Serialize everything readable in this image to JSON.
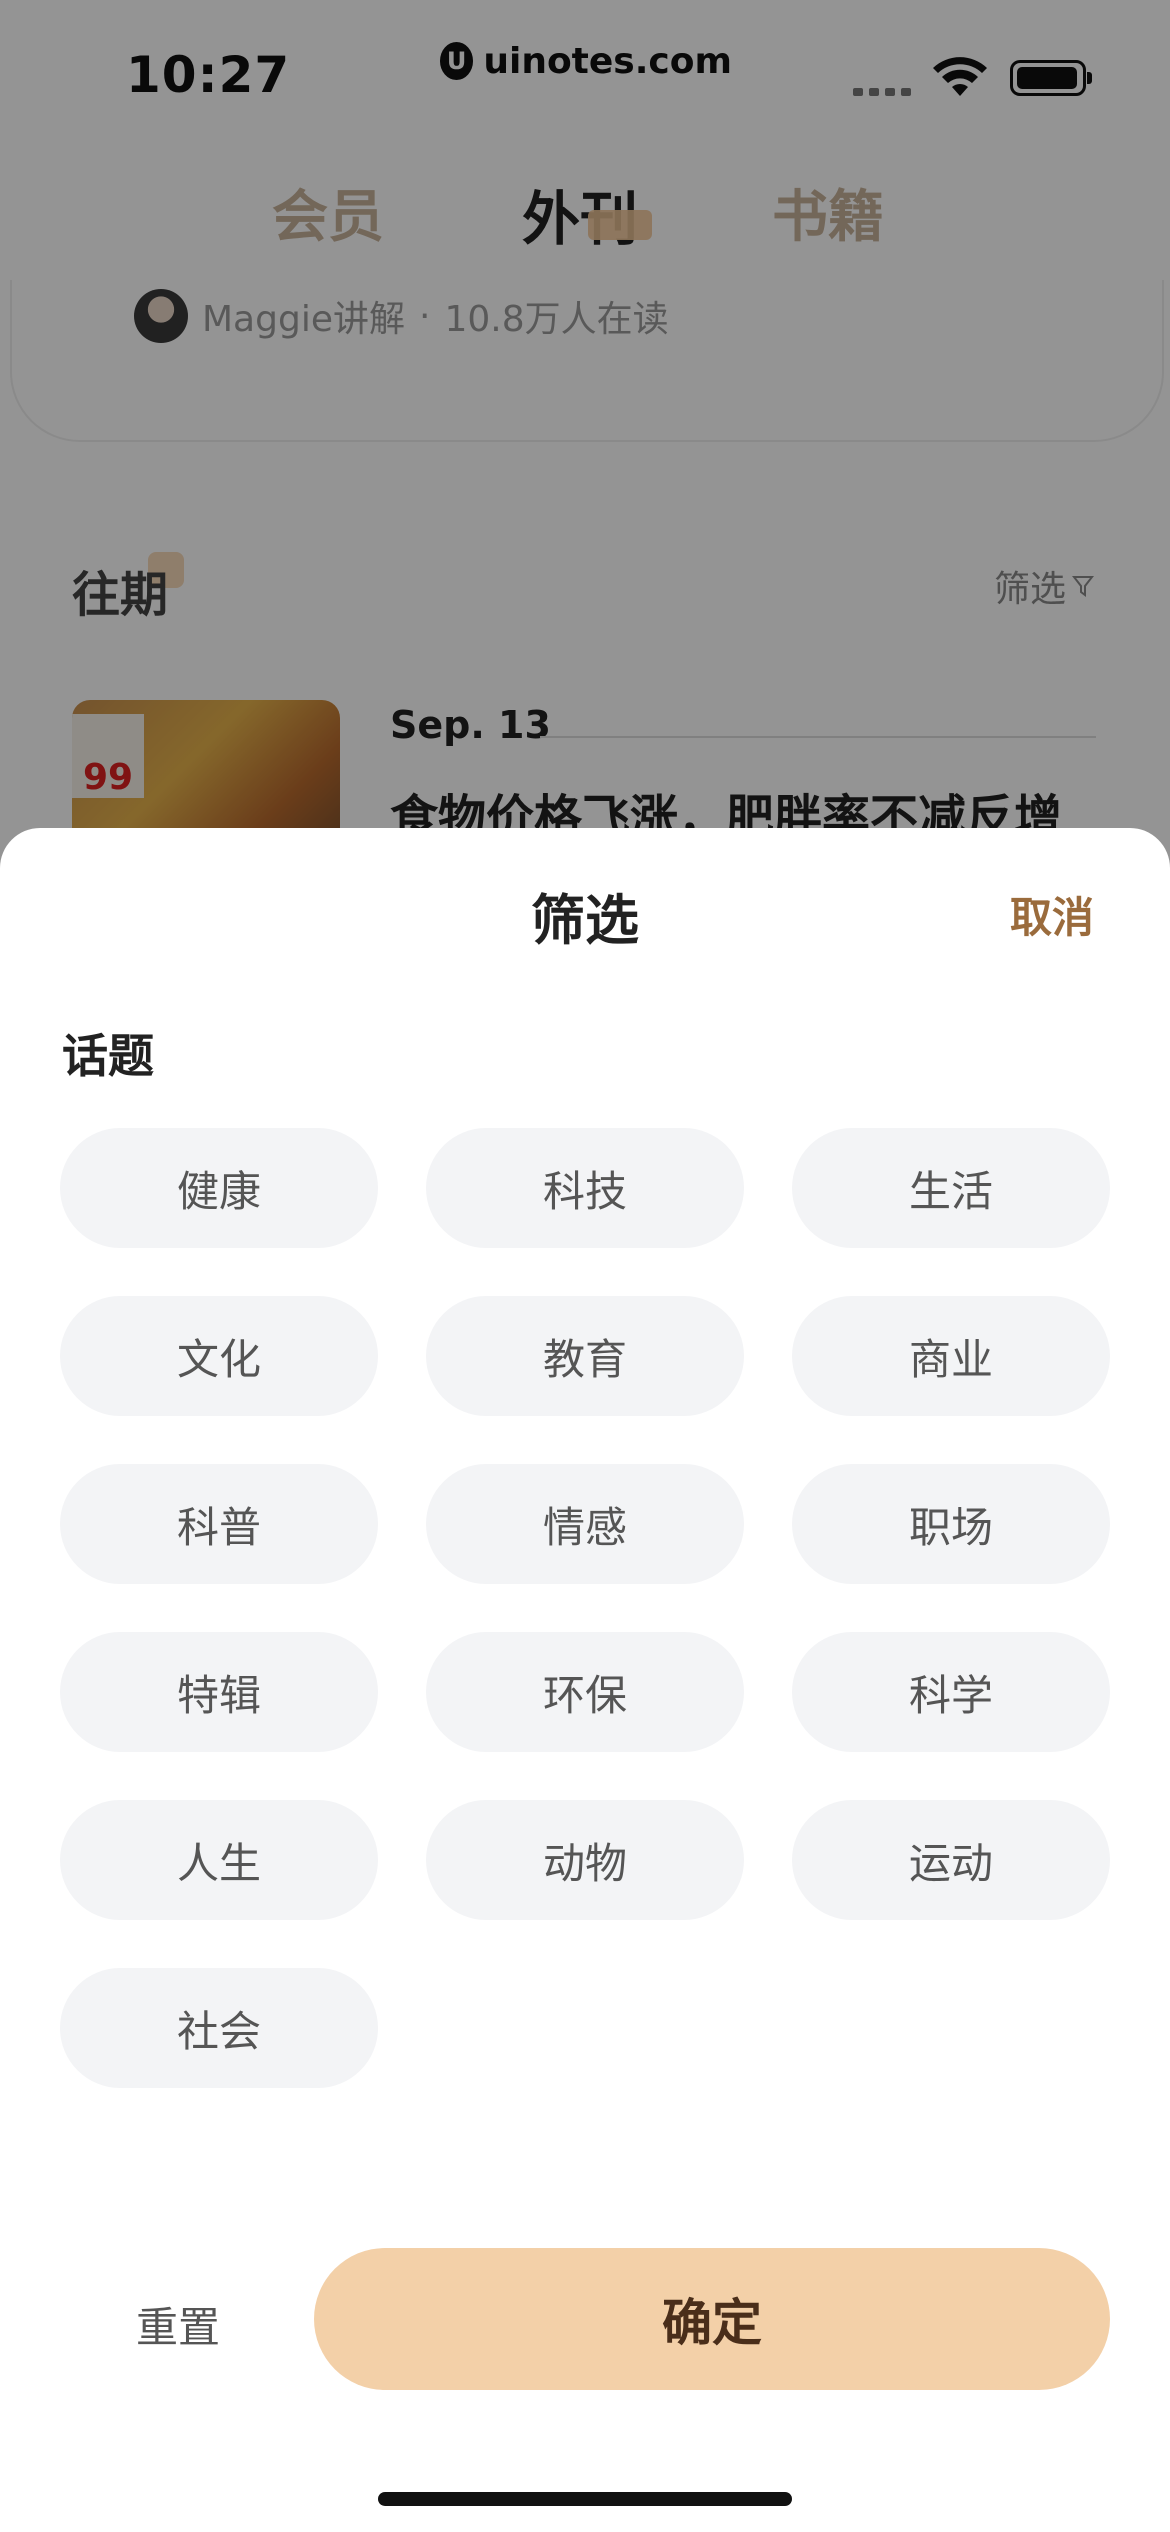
{
  "status": {
    "time": "10:27"
  },
  "watermark": {
    "text": "uinotes.com"
  },
  "tabs": [
    {
      "label": "会员"
    },
    {
      "label": "外刊"
    },
    {
      "label": "书籍"
    }
  ],
  "author": {
    "name": "Maggie讲解",
    "separator": "·",
    "readers": "10.8万人在读"
  },
  "past": {
    "title": "往期",
    "filter_label": "筛选"
  },
  "article": {
    "date": "Sep. 13",
    "title": "食物价格飞涨，肥胖率不减反增",
    "tag_price": "99"
  },
  "sheet": {
    "title": "筛选",
    "cancel_label": "取消",
    "topic_label": "话题",
    "topics": [
      "健康",
      "科技",
      "生活",
      "文化",
      "教育",
      "商业",
      "科普",
      "情感",
      "职场",
      "特辑",
      "环保",
      "科学",
      "人生",
      "动物",
      "运动",
      "社会"
    ],
    "reset_label": "重置",
    "confirm_label": "确定"
  },
  "colors": {
    "accent": "#f3d0a8",
    "cancel": "#9a6b3c",
    "chip_bg": "#f3f4f6"
  }
}
